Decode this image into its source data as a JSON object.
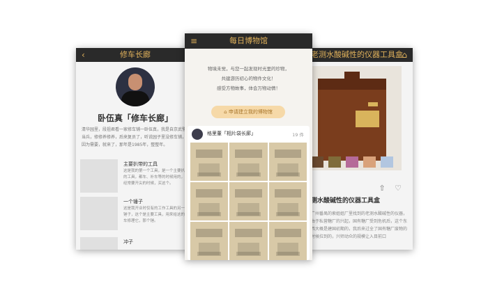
{
  "left_screen": {
    "title": "修车长廊",
    "back_icon": "chevron-left-icon",
    "name": "卧伍真「修车长廊」",
    "description": "清华园里，段祖君看一家修车铺一卧伍真，我是自京武警当兵，修修养修养，后来复员了，听说园子里没修车铺，因为需要，就来了，那年是1985年，整整年。",
    "items": [
      {
        "title": "主要扒带的工具",
        "text": "这是我的第一个工具，是一个主要扒带的工具，都车、补车等的时候用的，我经常要开尖的时候，买这个。"
      },
      {
        "title": "一个锤子",
        "text": "这是我开业时仅有的工作工具的另一个锤子，这个是主要工具，用来给这的老车修理它，那个锤。"
      },
      {
        "title": "冲子",
        "text": ""
      }
    ]
  },
  "center_screen": {
    "title": "每日博物馆",
    "menu_icon": "hamburger-menu-icon",
    "intro": "物境未觉，与您一起发现时光里的珍物，\n共建游历初心的物件文化！\n感受方物故事，体会万物动情！",
    "apply_label": "申请建立我的博物馆",
    "apply_icon": "museum-icon",
    "museum": {
      "owner": "格里董「相片袋长廊」",
      "count": "19 件",
      "images": [
        "photo-envelope-1",
        "photo-envelope-2",
        "photo-envelope-3",
        "photo-envelope-4",
        "photo-envelope-5",
        "photo-envelope-6",
        "photo-envelope-7",
        "photo-envelope-8",
        "photo-envelope-9"
      ]
    }
  },
  "right_screen": {
    "title": "老测水酸碱性的仪器工具盒",
    "action_icon": "museum-icon",
    "share_icon": "share-icon",
    "like_icon": "heart-icon",
    "object_title": "测水酸碱性的仪器工具盒",
    "text": "广州番禺的索姐姐厂里找到的老测水酸碱性的仪器，由于私营糖厂的兴起，国有糖厂受到危机后，这个东西大概是建国初期的，我后来过全了国有糖厂废物的时候拉到的，兴师动众的规模让入目前口"
  },
  "colors": {
    "bar": "#2a2a2a",
    "accent": "#e0b15b",
    "apply_bg": "#f6d9a8"
  }
}
